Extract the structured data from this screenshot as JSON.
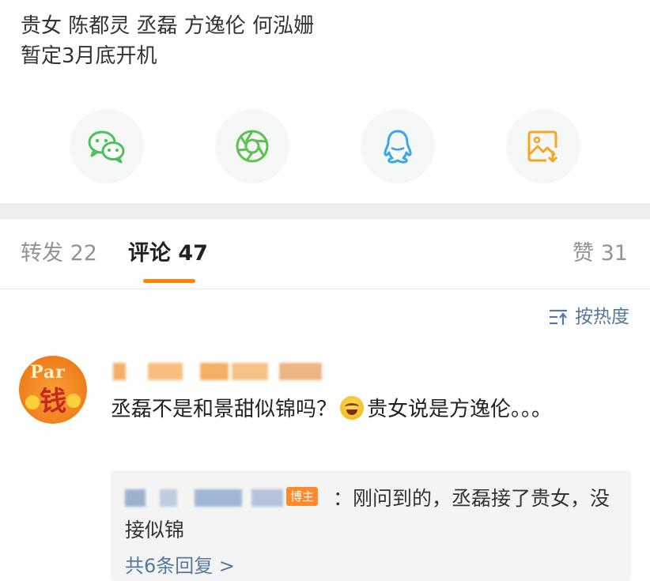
{
  "post": {
    "line1": "贵女 陈都灵 丞磊 方逸伦 何泓姗",
    "line2": "暂定3月底开机"
  },
  "share": {
    "items": [
      {
        "icon": "wechat-icon",
        "color": "#4fbf5a"
      },
      {
        "icon": "moments-icon",
        "color": "#5cc24f"
      },
      {
        "icon": "qq-icon",
        "color": "#3aa6e8"
      },
      {
        "icon": "save-image-icon",
        "color": "#f5a623"
      }
    ]
  },
  "tabs": {
    "repost": "转发 22",
    "comments": "评论 47",
    "likes": "赞 31",
    "accent": "#ff8200"
  },
  "sort": {
    "label": "按热度"
  },
  "comment": {
    "avatar_top": "Par",
    "avatar_mid": "钱",
    "text_before_emoji": "丞磊不是和景甜似锦吗？",
    "emoji": "laughing-tears-emoji",
    "text_after_emoji": "贵女说是方逸伦。。。",
    "reply": {
      "badge": "博主",
      "text": "：刚问到的，丞磊接了贵女，没接似锦",
      "more": "共6条回复 >"
    }
  }
}
